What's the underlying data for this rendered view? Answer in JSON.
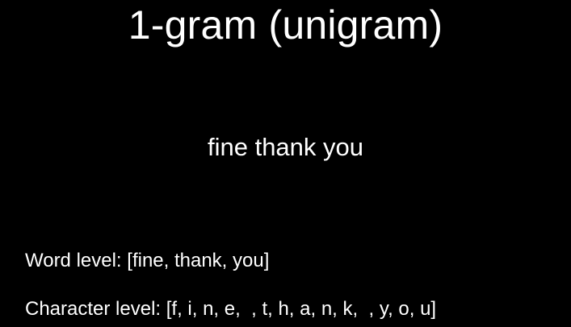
{
  "slide": {
    "title": "1-gram (unigram)",
    "phrase": "fine thank you",
    "word_level": "Word level: [fine, thank, you]",
    "character_level": "Character level: [f, i, n, e,  , t, h, a, n, k,  , y, o, u]"
  },
  "colors": {
    "background": "#000000",
    "text": "#ffffff"
  }
}
